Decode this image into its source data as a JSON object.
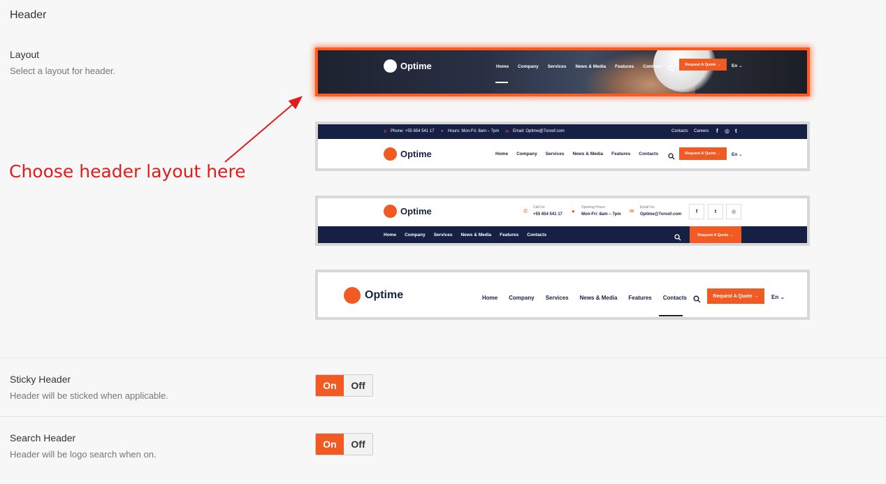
{
  "section_title": "Header",
  "layout": {
    "label": "Layout",
    "desc": "Select a layout for header."
  },
  "annotation": "Choose header layout here",
  "brand": "Optime",
  "nav": [
    "Home",
    "Company",
    "Services",
    "News & Media",
    "Features",
    "Contacts"
  ],
  "quote_btn": "Request A Quote →",
  "lang": "En ⌄",
  "layout2": {
    "phone": "Phone: +55 654 541 17",
    "hours": "Hours: Mon-Fri: 8am – 7pm",
    "email": "Email: Optime@7oroof.com",
    "links": [
      "Contacts",
      "Careers"
    ],
    "social": [
      "f",
      "◎",
      "t"
    ]
  },
  "layout3": {
    "call_label": "Call Us:",
    "call_value": "+55 654 541 17",
    "hours_label": "Opening Hours:",
    "hours_value": "Mon-Fri: 8am – 7pm",
    "email_label": "Email Us:",
    "email_value": "Optime@7oroof.com",
    "social": [
      "f",
      "t",
      "◎"
    ]
  },
  "sticky": {
    "label": "Sticky Header",
    "desc": "Header will be sticked when applicable.",
    "on": "On",
    "off": "Off"
  },
  "search": {
    "label": "Search Header",
    "desc": "Header will be logo search when on.",
    "on": "On",
    "off": "Off"
  },
  "colors": {
    "accent": "#f15a22",
    "navy": "#162044",
    "annotation": "#e21b1b"
  }
}
